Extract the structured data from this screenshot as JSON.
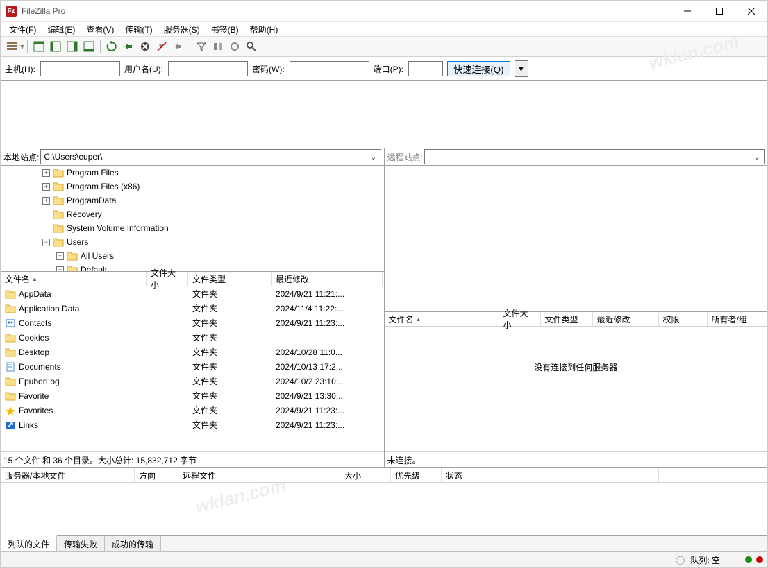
{
  "title": "FileZilla Pro",
  "app_icon": "Fz",
  "menu": [
    "文件(F)",
    "编辑(E)",
    "查看(V)",
    "传输(T)",
    "服务器(S)",
    "书签(B)",
    "帮助(H)"
  ],
  "quickconnect": {
    "host_label": "主机(H):",
    "user_label": "用户名(U):",
    "pass_label": "密码(W):",
    "port_label": "端口(P):",
    "button": "快速连接(Q)"
  },
  "local": {
    "label": "本地站点:",
    "path": "C:\\Users\\euper\\",
    "tree": [
      {
        "indent": 60,
        "tw": "+",
        "label": "Program Files"
      },
      {
        "indent": 60,
        "tw": "+",
        "label": "Program Files (x86)"
      },
      {
        "indent": 60,
        "tw": "+",
        "label": "ProgramData"
      },
      {
        "indent": 60,
        "tw": "",
        "label": "Recovery"
      },
      {
        "indent": 60,
        "tw": "",
        "label": "System Volume Information"
      },
      {
        "indent": 60,
        "tw": "-",
        "label": "Users"
      },
      {
        "indent": 80,
        "tw": "+",
        "label": "All Users"
      },
      {
        "indent": 80,
        "tw": "+",
        "label": "Default"
      }
    ],
    "headers": [
      "文件名",
      "文件大小",
      "文件类型",
      "最近修改"
    ],
    "header_widths": [
      210,
      60,
      120,
      160
    ],
    "files": [
      {
        "icon": "folder",
        "name": "AppData",
        "type": "文件夹",
        "date": "2024/9/21 11:21:..."
      },
      {
        "icon": "folder",
        "name": "Application Data",
        "type": "文件夹",
        "date": "2024/11/4 11:22:..."
      },
      {
        "icon": "contacts",
        "name": "Contacts",
        "type": "文件夹",
        "date": "2024/9/21 11:23:..."
      },
      {
        "icon": "folder",
        "name": "Cookies",
        "type": "文件夹",
        "date": ""
      },
      {
        "icon": "folder",
        "name": "Desktop",
        "type": "文件夹",
        "date": "2024/10/28 11:0..."
      },
      {
        "icon": "doc",
        "name": "Documents",
        "type": "文件夹",
        "date": "2024/10/13 17:2..."
      },
      {
        "icon": "folder",
        "name": "EpuborLog",
        "type": "文件夹",
        "date": "2024/10/2 23:10:..."
      },
      {
        "icon": "folder",
        "name": "Favorite",
        "type": "文件夹",
        "date": "2024/9/21 13:30:..."
      },
      {
        "icon": "star",
        "name": "Favorites",
        "type": "文件夹",
        "date": "2024/9/21 11:23:..."
      },
      {
        "icon": "link",
        "name": "Links",
        "type": "文件夹",
        "date": "2024/9/21 11:23:..."
      }
    ],
    "status": "15 个文件 和 36 个目录。大小总计: 15,832,712 字节"
  },
  "remote": {
    "label": "远程站点:",
    "headers": [
      "文件名",
      "文件大小",
      "文件类型",
      "最近修改",
      "权限",
      "所有者/组"
    ],
    "header_widths": [
      165,
      60,
      75,
      95,
      70,
      70
    ],
    "empty": "没有连接到任何服务器",
    "status": "未连接。"
  },
  "queue": {
    "headers": [
      "服务器/本地文件",
      "方向",
      "远程文件",
      "大小",
      "优先级",
      "状态"
    ],
    "header_widths": [
      180,
      50,
      220,
      60,
      60,
      300
    ],
    "tabs": [
      "列队的文件",
      "传输失败",
      "成功的传输"
    ]
  },
  "statusbar": {
    "queue": "队列: 空"
  },
  "watermark": "wklan.com"
}
